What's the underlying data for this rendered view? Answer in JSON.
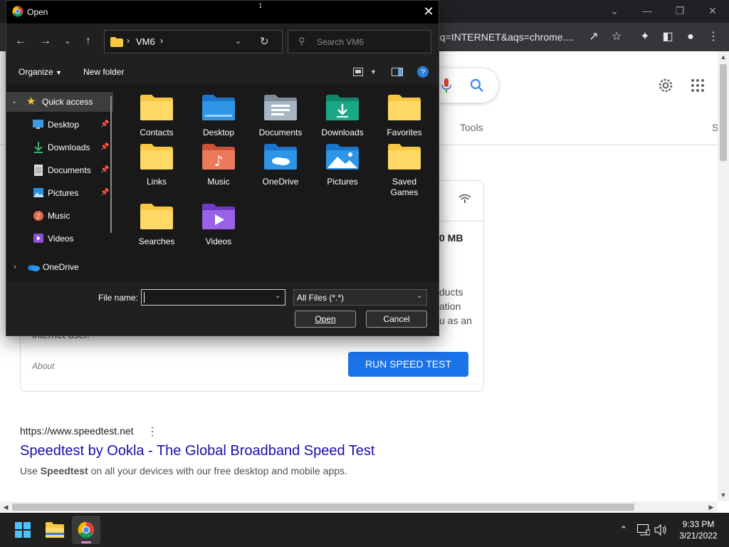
{
  "browser": {
    "omnibox_text": "oq=INTERNET&aqs=chrome....",
    "page": {
      "tools_label": "Tools",
      "tab_s": "S",
      "speed_card": {
        "mb_value": "0 MB",
        "text_lines": [
          "ducts",
          "ation",
          "u as an",
          "internet user."
        ],
        "about_label": "About",
        "run_button": "RUN SPEED TEST"
      },
      "result": {
        "url": "https://www.speedtest.net",
        "title": "Speedtest by Ookla - The Global Broadband Speed Test",
        "snippet_prefix": "Use ",
        "snippet_bold": "Speedtest",
        "snippet_suffix": " on all your devices with our free desktop and mobile apps."
      }
    }
  },
  "dialog": {
    "title": "Open",
    "address": {
      "folder": "VM6"
    },
    "search_placeholder": "Search VM6",
    "commands": {
      "organize": "Organize",
      "new_folder": "New folder"
    },
    "nav_items": [
      {
        "label": "Quick access",
        "icon": "star-icon",
        "selected": true
      },
      {
        "label": "Desktop",
        "icon": "desktop-icon",
        "pinned": true
      },
      {
        "label": "Downloads",
        "icon": "download-icon",
        "pinned": true
      },
      {
        "label": "Documents",
        "icon": "document-icon",
        "pinned": true
      },
      {
        "label": "Pictures",
        "icon": "pictures-icon",
        "pinned": true
      },
      {
        "label": "Music",
        "icon": "music-icon",
        "pinned": false
      },
      {
        "label": "Videos",
        "icon": "videos-icon",
        "pinned": false
      },
      {
        "label": "OneDrive",
        "icon": "onedrive-icon",
        "pinned": false
      }
    ],
    "files": [
      {
        "label": "Contacts",
        "icon": "folder-icon"
      },
      {
        "label": "Desktop",
        "icon": "desktop-folder-icon"
      },
      {
        "label": "Documents",
        "icon": "documents-folder-icon"
      },
      {
        "label": "Downloads",
        "icon": "downloads-folder-icon"
      },
      {
        "label": "Favorites",
        "icon": "folder-icon"
      },
      {
        "label": "Links",
        "icon": "folder-icon"
      },
      {
        "label": "Music",
        "icon": "music-folder-icon"
      },
      {
        "label": "OneDrive",
        "icon": "onedrive-folder-icon"
      },
      {
        "label": "Pictures",
        "icon": "pictures-folder-icon"
      },
      {
        "label": "Saved Games",
        "icon": "folder-icon"
      },
      {
        "label": "Searches",
        "icon": "folder-icon"
      },
      {
        "label": "Videos",
        "icon": "videos-folder-icon"
      }
    ],
    "file_name_label": "File name:",
    "file_name_value": "",
    "filter_value": "All Files (*.*)",
    "open_button": "Open",
    "cancel_button": "Cancel"
  },
  "taskbar": {
    "time": "9:33 PM",
    "date": "3/21/2022"
  },
  "colors": {
    "dialog_bg": "#202020",
    "pane_bg": "#191919",
    "folder_yellow": "#f8c843",
    "accent_blue": "#1a73e8",
    "link_blue": "#1a0dab"
  }
}
